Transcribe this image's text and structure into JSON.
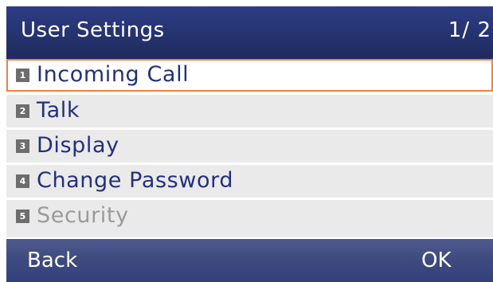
{
  "header": {
    "title": "User Settings",
    "page_indicator": "1/ 2"
  },
  "menu": {
    "items": [
      {
        "number": "1",
        "label": "Incoming Call",
        "state": "selected"
      },
      {
        "number": "2",
        "label": "Talk",
        "state": "normal"
      },
      {
        "number": "3",
        "label": "Display",
        "state": "normal"
      },
      {
        "number": "4",
        "label": "Change Password",
        "state": "normal"
      },
      {
        "number": "5",
        "label": "Security",
        "state": "disabled"
      }
    ]
  },
  "softkeys": {
    "left": "Back",
    "right": "OK"
  },
  "colors": {
    "header_bg": "#25336f",
    "softkey_bg": "#3e4a7f",
    "item_bg": "#eaeaea",
    "item_text": "#23307a",
    "selection_border": "#f2813a",
    "disabled_text": "#9a9a9a"
  }
}
